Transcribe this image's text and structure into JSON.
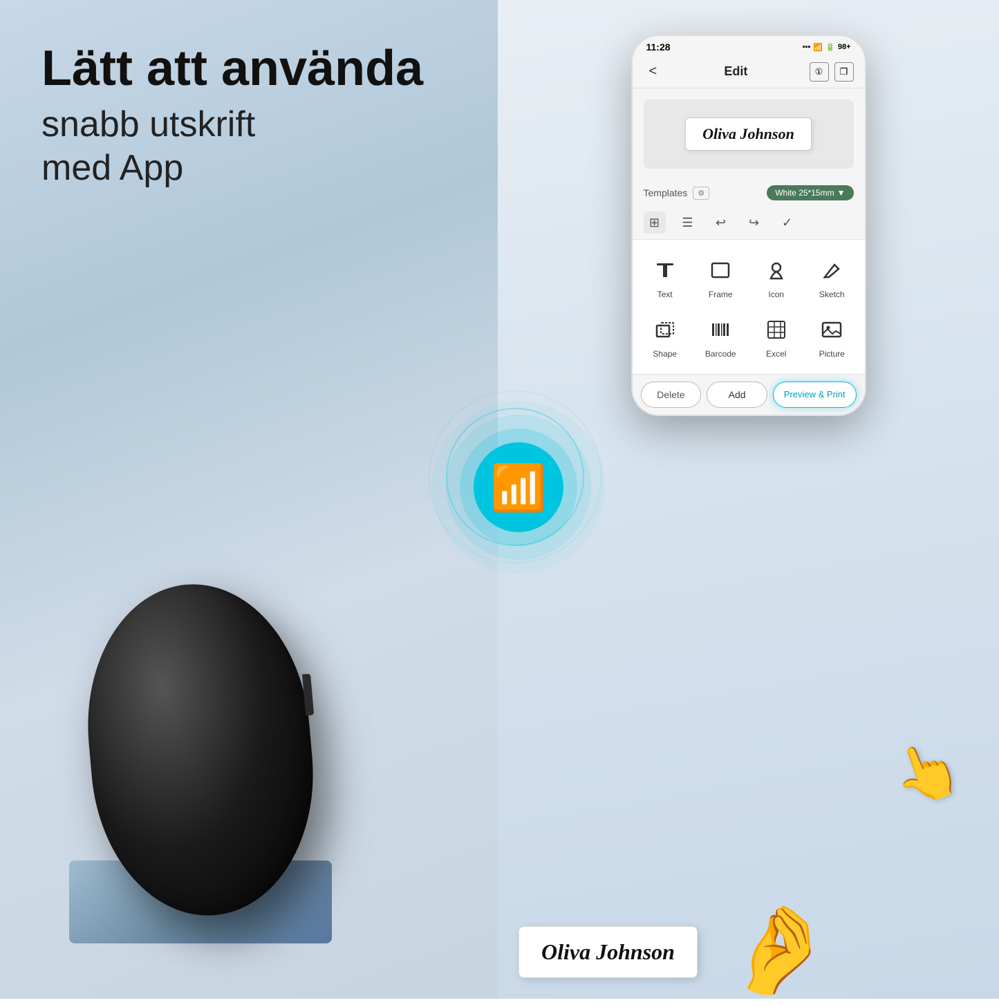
{
  "left": {
    "headline": "Lätt att använda",
    "subline_line1": "snabb utskrift",
    "subline_line2": "med App"
  },
  "phone": {
    "status_time": "11:28",
    "status_battery": "98+",
    "header_title": "Edit",
    "label_text": "Oliva Johnson",
    "template_label": "Templates",
    "size_label": "White 25*15mm",
    "tools": [
      {
        "name": "Text",
        "icon": "T"
      },
      {
        "name": "Frame",
        "icon": "▭"
      },
      {
        "name": "Icon",
        "icon": "☆"
      },
      {
        "name": "Sketch",
        "icon": "✏"
      },
      {
        "name": "Shape",
        "icon": "◱"
      },
      {
        "name": "Barcode",
        "icon": "|||"
      },
      {
        "name": "Excel",
        "icon": "⊞"
      },
      {
        "name": "Picture",
        "icon": "🖼"
      }
    ],
    "btn_delete": "Delete",
    "btn_add": "Add",
    "btn_print": "Preview & Print"
  },
  "printed_label": "Oliva Johnson"
}
